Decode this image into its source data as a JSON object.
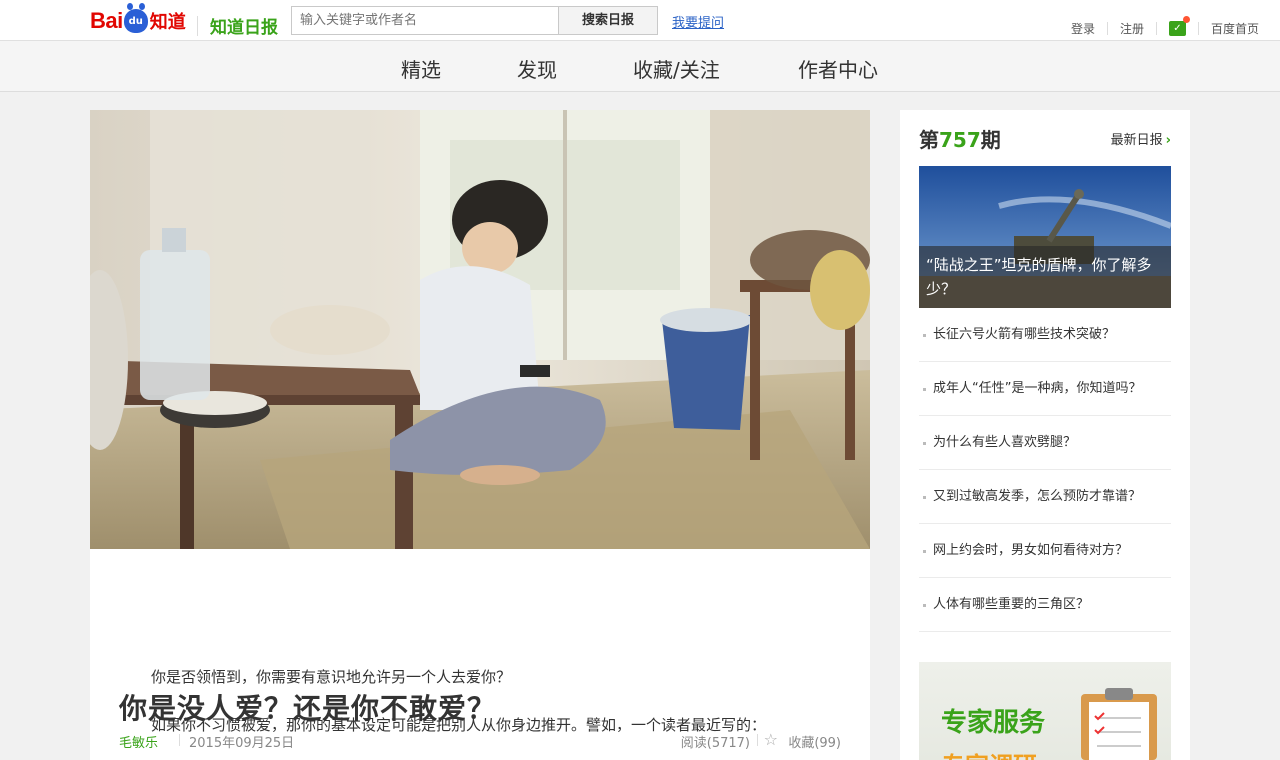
{
  "header": {
    "logo_bai": "Bai",
    "logo_du": "du",
    "logo_zhidao": "知道",
    "logo_daily": "知道日报",
    "search_placeholder": "输入关键字或作者名",
    "search_button": "搜索日报",
    "ask_link": "我要提问",
    "login": "登录",
    "register": "注册",
    "baidu_home": "百度首页"
  },
  "nav": {
    "items": [
      "精选",
      "发现",
      "收藏/关注",
      "作者中心"
    ]
  },
  "article": {
    "title": "你是没人爱？还是你不敢爱？",
    "author": "毛敏乐",
    "date": "2015年09月25日",
    "reads": "阅读(5717)",
    "favorites": "收藏(99)",
    "paragraphs": [
      "你是否领悟到，你需要有意识地允许另一个人去爱你？",
      "如果你不习惯被爱，那你的基本设定可能是把别人从你身边推开。譬如，一个读者最近写的："
    ]
  },
  "sidebar": {
    "issue_prefix": "第",
    "issue_number": "757",
    "issue_suffix": "期",
    "latest_label": "最新日报",
    "feature_caption": "“陆战之王”坦克的盾牌，你了解多少？",
    "items": [
      "长征六号火箭有哪些技术突破？",
      "成年人“任性”是一种病，你知道吗？",
      "为什么有些人喜欢劈腿？",
      "又到过敏高发季，怎么预防才靠谱？",
      "网上约会时，男女如何看待对方？",
      "人体有哪些重要的三角区？"
    ],
    "ad_title": "专家服务",
    "ad_sub": "专家调研"
  },
  "colors": {
    "brand_red": "#e10601",
    "brand_green": "#3aa31a",
    "link_blue": "#2a62c6"
  }
}
